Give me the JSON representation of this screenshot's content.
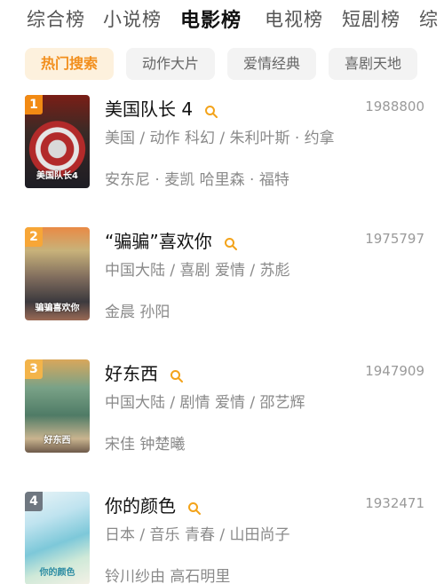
{
  "top_tabs": [
    {
      "label": "综合榜",
      "active": false
    },
    {
      "label": "小说榜",
      "active": false
    },
    {
      "label": "电影榜",
      "active": true
    },
    {
      "label": "电视榜",
      "active": false
    },
    {
      "label": "短剧榜",
      "active": false
    },
    {
      "label": "综",
      "active": false
    }
  ],
  "filter_chips": [
    {
      "label": "热门搜索",
      "active": true
    },
    {
      "label": "动作大片",
      "active": false
    },
    {
      "label": "爱情经典",
      "active": false
    },
    {
      "label": "喜剧天地",
      "active": false
    }
  ],
  "colors": {
    "accent": "#f28f1d",
    "rank_1": "#f28a13",
    "rank_2": "#f7a637",
    "rank_3": "#f3b44a",
    "rank_4": "#6f7780",
    "score": "#9a9a9a",
    "meta": "#8a8a8a"
  },
  "movies": [
    {
      "rank": "1",
      "title": "美国队长 4",
      "score": "1988800",
      "meta": "美国 / 动作 科幻 / 朱利叶斯 · 约拿",
      "cast": "安东尼 · 麦凯 哈里森 · 福特",
      "poster_caption": "美国队长4",
      "icon": "search-icon"
    },
    {
      "rank": "2",
      "title": "“骗骗”喜欢你",
      "score": "1975797",
      "meta": "中国大陆 / 喜剧 爱情 / 苏彪",
      "cast": "金晨 孙阳",
      "poster_caption": "骗骗喜欢你",
      "icon": "search-icon"
    },
    {
      "rank": "3",
      "title": "好东西",
      "score": "1947909",
      "meta": "中国大陆 / 剧情 爱情 / 邵艺辉",
      "cast": "宋佳 钟楚曦",
      "poster_caption": "好东西",
      "icon": "search-icon"
    },
    {
      "rank": "4",
      "title": "你的颜色",
      "score": "1932471",
      "meta": "日本 / 音乐 青春 / 山田尚子",
      "cast": "铃川纱由 高石明里",
      "poster_caption": "你的颜色",
      "icon": "search-icon"
    }
  ]
}
